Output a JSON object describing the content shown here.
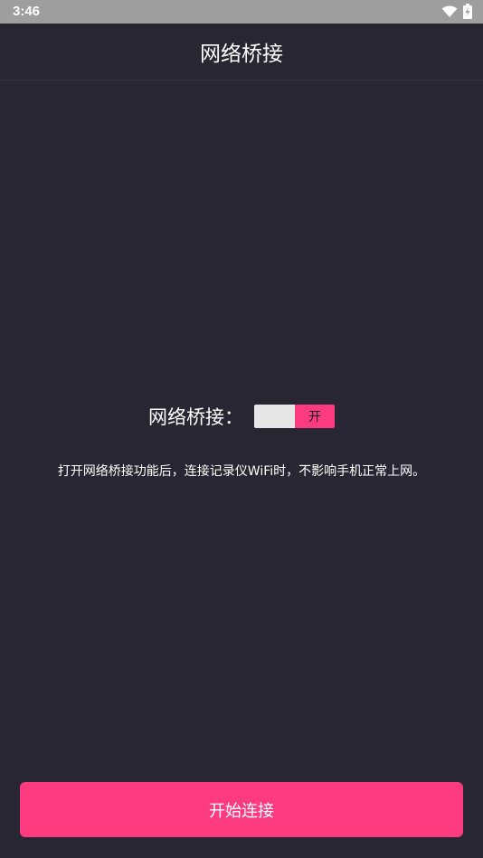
{
  "status_bar": {
    "time": "3:46",
    "wifi_icon": "wifi-icon",
    "battery_icon": "battery-charging-icon"
  },
  "app_bar": {
    "title": "网络桥接"
  },
  "bridge": {
    "label": "网络桥接：",
    "toggle_on_label": "开",
    "toggle_state": "on",
    "accent_color": "#ff3b7f"
  },
  "description": "打开网络桥接功能后，连接记录仪WiFi时，不影响手机正常上网。",
  "start_button": {
    "label": "开始连接"
  },
  "colors": {
    "background": "#282632",
    "status_bar": "#9e9e9e",
    "accent": "#ff3b7f"
  }
}
